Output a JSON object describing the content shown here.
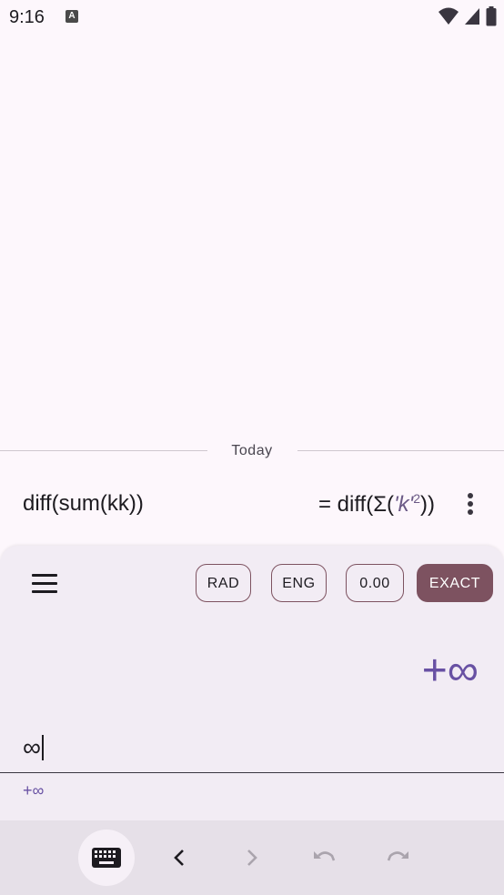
{
  "status": {
    "time": "9:16",
    "notification_letter": "A"
  },
  "history": {
    "section_label": "Today",
    "entry": {
      "expression": "diff(sum(kk))",
      "result_prefix": "= diff(Σ(",
      "result_quoted": "'k'",
      "result_exponent": "2",
      "result_suffix": "))"
    }
  },
  "modes": {
    "rad": "RAD",
    "eng": "ENG",
    "decimals": "0.00",
    "exact": "EXACT",
    "active": "EXACT"
  },
  "display": {
    "result": "+∞",
    "input": "∞",
    "preview": "+∞"
  },
  "colors": {
    "accent": "#7d5260",
    "result": "#6851a3",
    "panel": "#f2ecf4"
  }
}
